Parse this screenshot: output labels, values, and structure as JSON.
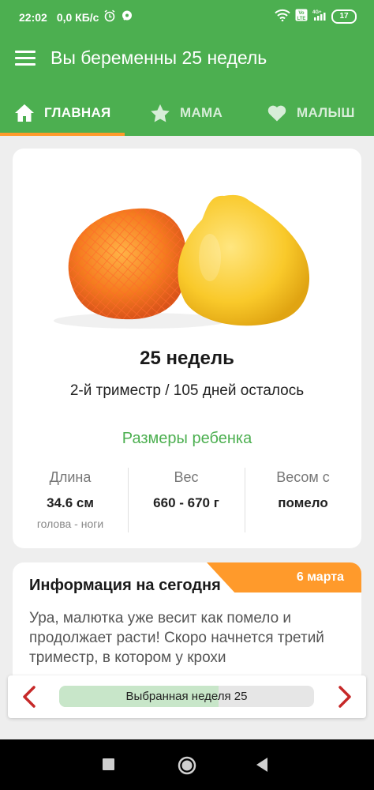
{
  "status_bar": {
    "time": "22:02",
    "net_speed": "0,0 КБ/с",
    "battery": "17",
    "icons": [
      "alarm-icon",
      "chat-icon",
      "wifi-icon",
      "volte-icon",
      "signal-4g-icon",
      "battery-icon"
    ]
  },
  "app_bar": {
    "title": "Вы беременны 25 недель",
    "menu_icon": "hamburger-menu-icon"
  },
  "tabs": [
    {
      "label": "ГЛАВНАЯ",
      "icon": "home-icon",
      "active": true
    },
    {
      "label": "МАМА",
      "icon": "star-icon",
      "active": false
    },
    {
      "label": "МАЛЫШ",
      "icon": "heart-icon",
      "active": false
    }
  ],
  "week_card": {
    "image": "pomelo-fruit-image",
    "weeks_label": "25 недель",
    "trimester_label": "2-й триместр / 105 дней осталось",
    "sizes_title": "Размеры ребенка",
    "metrics": [
      {
        "label": "Длина",
        "value": "34.6 см",
        "sub": "голова - ноги"
      },
      {
        "label": "Вес",
        "value": "660 - 670 г",
        "sub": ""
      },
      {
        "label": "Весом с",
        "value": "помело",
        "sub": ""
      }
    ]
  },
  "info_card": {
    "title": "Информация на сегодня",
    "date": "6 марта",
    "text": "Ура, малютка уже весит как помело и продолжает расти! Скоро начнется третий триместр, в котором у крохи"
  },
  "week_nav": {
    "label": "Выбранная неделя 25",
    "progress": 0.625,
    "prev_icon": "chevron-left-icon",
    "next_icon": "chevron-right-icon"
  },
  "colors": {
    "primary": "#4caf50",
    "accent": "#ff9a2b",
    "arrow": "#c62828"
  }
}
